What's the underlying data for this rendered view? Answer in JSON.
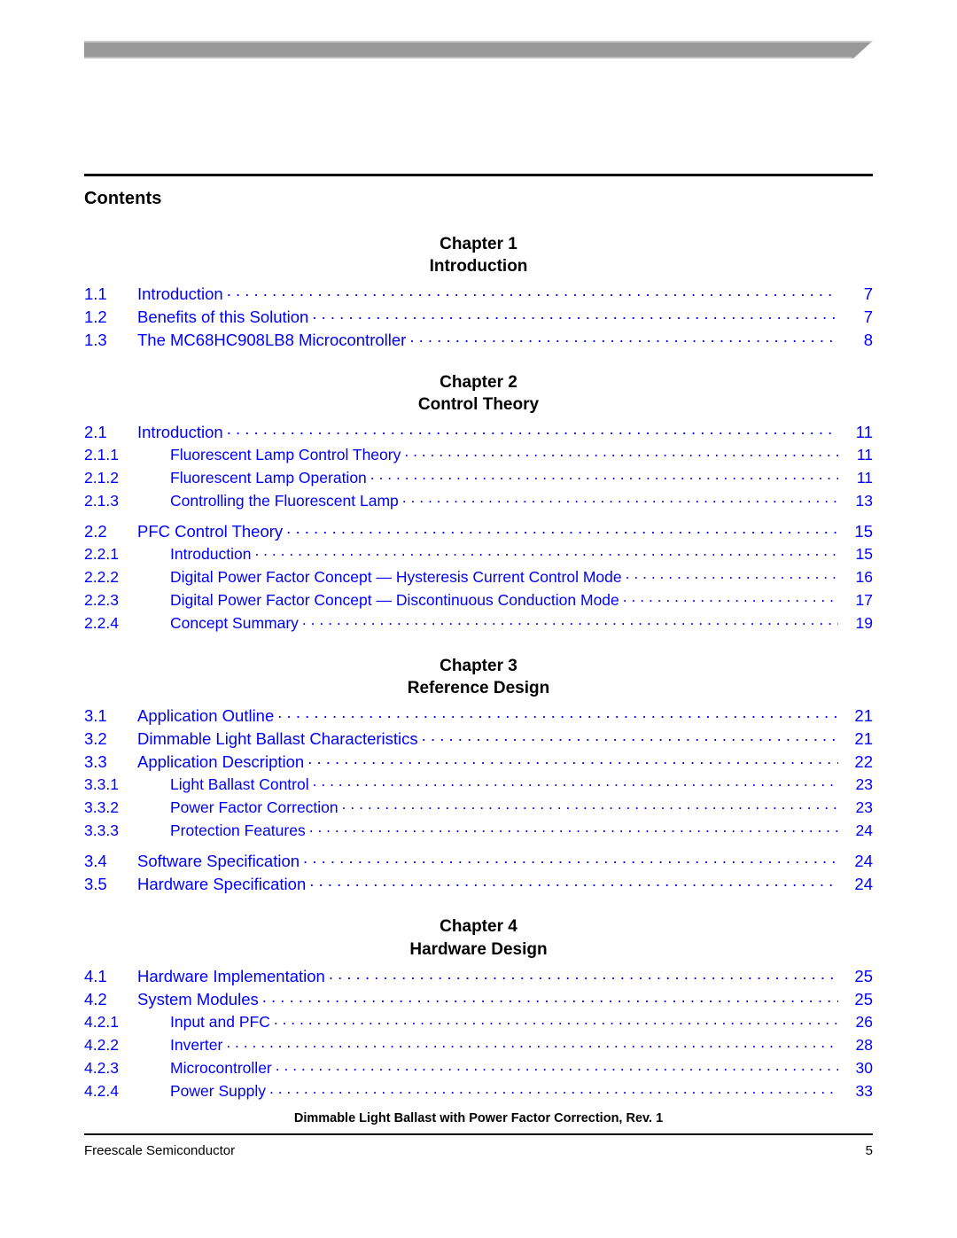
{
  "document": {
    "contents_heading": "Contents",
    "footer_doc_title": "Dimmable Light Ballast with Power Factor Correction, Rev. 1",
    "footer_company": "Freescale Semiconductor",
    "footer_page_number": "5"
  },
  "colors": {
    "link_blue": "#0000FF",
    "text_black": "#000000",
    "banner_gray": "#999999"
  },
  "chapters": [
    {
      "label": "Chapter 1",
      "title": "Introduction",
      "entries": [
        {
          "num": "1.1",
          "level": 2,
          "title": "Introduction",
          "page": "7"
        },
        {
          "num": "1.2",
          "level": 2,
          "title": "Benefits of this Solution",
          "page": "7"
        },
        {
          "num": "1.3",
          "level": 2,
          "title": "The MC68HC908LB8 Microcontroller",
          "page": "8"
        }
      ]
    },
    {
      "label": "Chapter 2",
      "title": "Control Theory",
      "entries": [
        {
          "num": "2.1",
          "level": 2,
          "title": "Introduction",
          "page": "11"
        },
        {
          "num": "2.1.1",
          "level": 3,
          "title": "Fluorescent Lamp Control Theory",
          "page": "11"
        },
        {
          "num": "2.1.2",
          "level": 3,
          "title": "Fluorescent Lamp Operation",
          "page": "11"
        },
        {
          "num": "2.1.3",
          "level": 3,
          "title": "Controlling the Fluorescent Lamp",
          "page": "13"
        },
        {
          "num": "2.2",
          "level": 2,
          "title": "PFC Control Theory",
          "page": "15"
        },
        {
          "num": "2.2.1",
          "level": 3,
          "title": "Introduction",
          "page": "15"
        },
        {
          "num": "2.2.2",
          "level": 3,
          "title": "Digital Power Factor Concept — Hysteresis Current Control Mode",
          "page": "16"
        },
        {
          "num": "2.2.3",
          "level": 3,
          "title": "Digital Power Factor Concept — Discontinuous Conduction Mode",
          "page": "17"
        },
        {
          "num": "2.2.4",
          "level": 3,
          "title": "Concept Summary",
          "page": "19"
        }
      ]
    },
    {
      "label": "Chapter 3",
      "title": "Reference Design",
      "entries": [
        {
          "num": "3.1",
          "level": 2,
          "title": "Application Outline",
          "page": "21"
        },
        {
          "num": "3.2",
          "level": 2,
          "title": "Dimmable Light Ballast Characteristics",
          "page": "21"
        },
        {
          "num": "3.3",
          "level": 2,
          "title": "Application Description",
          "page": "22"
        },
        {
          "num": "3.3.1",
          "level": 3,
          "title": "Light Ballast Control",
          "page": "23"
        },
        {
          "num": "3.3.2",
          "level": 3,
          "title": "Power Factor Correction",
          "page": "23"
        },
        {
          "num": "3.3.3",
          "level": 3,
          "title": "Protection Features",
          "page": "24"
        },
        {
          "num": "3.4",
          "level": 2,
          "title": "Software Specification",
          "page": "24"
        },
        {
          "num": "3.5",
          "level": 2,
          "title": "Hardware Specification",
          "page": "24"
        }
      ]
    },
    {
      "label": "Chapter 4",
      "title": "Hardware Design",
      "entries": [
        {
          "num": "4.1",
          "level": 2,
          "title": "Hardware Implementation",
          "page": "25"
        },
        {
          "num": "4.2",
          "level": 2,
          "title": "System Modules",
          "page": "25"
        },
        {
          "num": "4.2.1",
          "level": 3,
          "title": "Input and PFC",
          "page": "26"
        },
        {
          "num": "4.2.2",
          "level": 3,
          "title": "Inverter",
          "page": "28"
        },
        {
          "num": "4.2.3",
          "level": 3,
          "title": "Microcontroller",
          "page": "30"
        },
        {
          "num": "4.2.4",
          "level": 3,
          "title": "Power Supply",
          "page": "33"
        }
      ]
    }
  ]
}
